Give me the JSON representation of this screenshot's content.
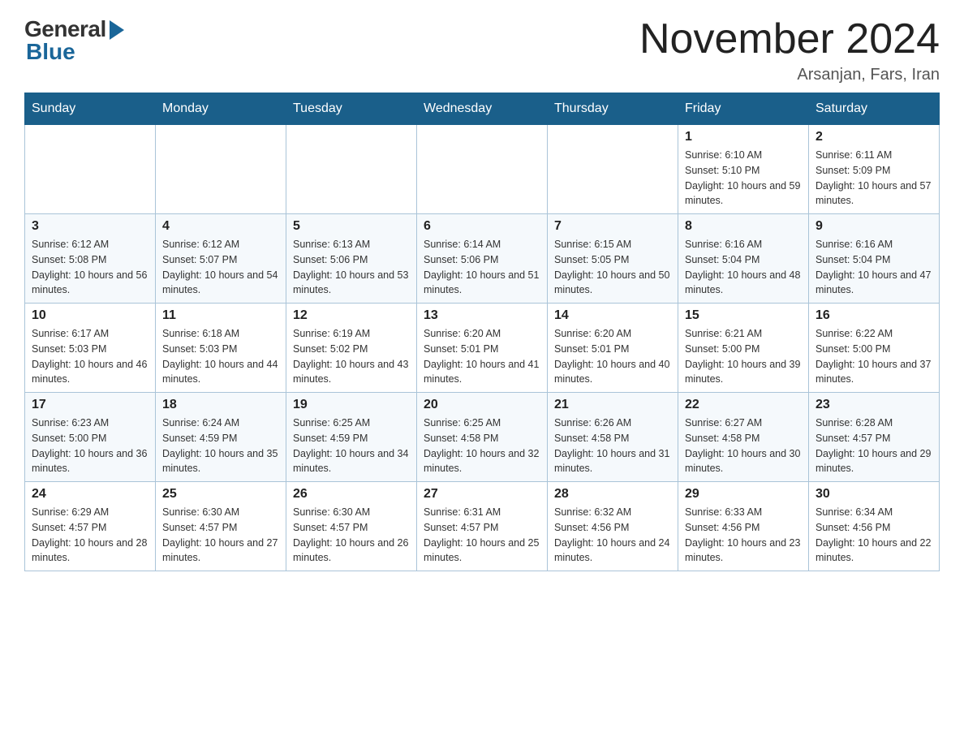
{
  "header": {
    "logo_general": "General",
    "logo_blue": "Blue",
    "title": "November 2024",
    "location": "Arsanjan, Fars, Iran"
  },
  "weekdays": [
    "Sunday",
    "Monday",
    "Tuesday",
    "Wednesday",
    "Thursday",
    "Friday",
    "Saturday"
  ],
  "weeks": [
    [
      {
        "day": "",
        "info": ""
      },
      {
        "day": "",
        "info": ""
      },
      {
        "day": "",
        "info": ""
      },
      {
        "day": "",
        "info": ""
      },
      {
        "day": "",
        "info": ""
      },
      {
        "day": "1",
        "info": "Sunrise: 6:10 AM\nSunset: 5:10 PM\nDaylight: 10 hours and 59 minutes."
      },
      {
        "day": "2",
        "info": "Sunrise: 6:11 AM\nSunset: 5:09 PM\nDaylight: 10 hours and 57 minutes."
      }
    ],
    [
      {
        "day": "3",
        "info": "Sunrise: 6:12 AM\nSunset: 5:08 PM\nDaylight: 10 hours and 56 minutes."
      },
      {
        "day": "4",
        "info": "Sunrise: 6:12 AM\nSunset: 5:07 PM\nDaylight: 10 hours and 54 minutes."
      },
      {
        "day": "5",
        "info": "Sunrise: 6:13 AM\nSunset: 5:06 PM\nDaylight: 10 hours and 53 minutes."
      },
      {
        "day": "6",
        "info": "Sunrise: 6:14 AM\nSunset: 5:06 PM\nDaylight: 10 hours and 51 minutes."
      },
      {
        "day": "7",
        "info": "Sunrise: 6:15 AM\nSunset: 5:05 PM\nDaylight: 10 hours and 50 minutes."
      },
      {
        "day": "8",
        "info": "Sunrise: 6:16 AM\nSunset: 5:04 PM\nDaylight: 10 hours and 48 minutes."
      },
      {
        "day": "9",
        "info": "Sunrise: 6:16 AM\nSunset: 5:04 PM\nDaylight: 10 hours and 47 minutes."
      }
    ],
    [
      {
        "day": "10",
        "info": "Sunrise: 6:17 AM\nSunset: 5:03 PM\nDaylight: 10 hours and 46 minutes."
      },
      {
        "day": "11",
        "info": "Sunrise: 6:18 AM\nSunset: 5:03 PM\nDaylight: 10 hours and 44 minutes."
      },
      {
        "day": "12",
        "info": "Sunrise: 6:19 AM\nSunset: 5:02 PM\nDaylight: 10 hours and 43 minutes."
      },
      {
        "day": "13",
        "info": "Sunrise: 6:20 AM\nSunset: 5:01 PM\nDaylight: 10 hours and 41 minutes."
      },
      {
        "day": "14",
        "info": "Sunrise: 6:20 AM\nSunset: 5:01 PM\nDaylight: 10 hours and 40 minutes."
      },
      {
        "day": "15",
        "info": "Sunrise: 6:21 AM\nSunset: 5:00 PM\nDaylight: 10 hours and 39 minutes."
      },
      {
        "day": "16",
        "info": "Sunrise: 6:22 AM\nSunset: 5:00 PM\nDaylight: 10 hours and 37 minutes."
      }
    ],
    [
      {
        "day": "17",
        "info": "Sunrise: 6:23 AM\nSunset: 5:00 PM\nDaylight: 10 hours and 36 minutes."
      },
      {
        "day": "18",
        "info": "Sunrise: 6:24 AM\nSunset: 4:59 PM\nDaylight: 10 hours and 35 minutes."
      },
      {
        "day": "19",
        "info": "Sunrise: 6:25 AM\nSunset: 4:59 PM\nDaylight: 10 hours and 34 minutes."
      },
      {
        "day": "20",
        "info": "Sunrise: 6:25 AM\nSunset: 4:58 PM\nDaylight: 10 hours and 32 minutes."
      },
      {
        "day": "21",
        "info": "Sunrise: 6:26 AM\nSunset: 4:58 PM\nDaylight: 10 hours and 31 minutes."
      },
      {
        "day": "22",
        "info": "Sunrise: 6:27 AM\nSunset: 4:58 PM\nDaylight: 10 hours and 30 minutes."
      },
      {
        "day": "23",
        "info": "Sunrise: 6:28 AM\nSunset: 4:57 PM\nDaylight: 10 hours and 29 minutes."
      }
    ],
    [
      {
        "day": "24",
        "info": "Sunrise: 6:29 AM\nSunset: 4:57 PM\nDaylight: 10 hours and 28 minutes."
      },
      {
        "day": "25",
        "info": "Sunrise: 6:30 AM\nSunset: 4:57 PM\nDaylight: 10 hours and 27 minutes."
      },
      {
        "day": "26",
        "info": "Sunrise: 6:30 AM\nSunset: 4:57 PM\nDaylight: 10 hours and 26 minutes."
      },
      {
        "day": "27",
        "info": "Sunrise: 6:31 AM\nSunset: 4:57 PM\nDaylight: 10 hours and 25 minutes."
      },
      {
        "day": "28",
        "info": "Sunrise: 6:32 AM\nSunset: 4:56 PM\nDaylight: 10 hours and 24 minutes."
      },
      {
        "day": "29",
        "info": "Sunrise: 6:33 AM\nSunset: 4:56 PM\nDaylight: 10 hours and 23 minutes."
      },
      {
        "day": "30",
        "info": "Sunrise: 6:34 AM\nSunset: 4:56 PM\nDaylight: 10 hours and 22 minutes."
      }
    ]
  ]
}
